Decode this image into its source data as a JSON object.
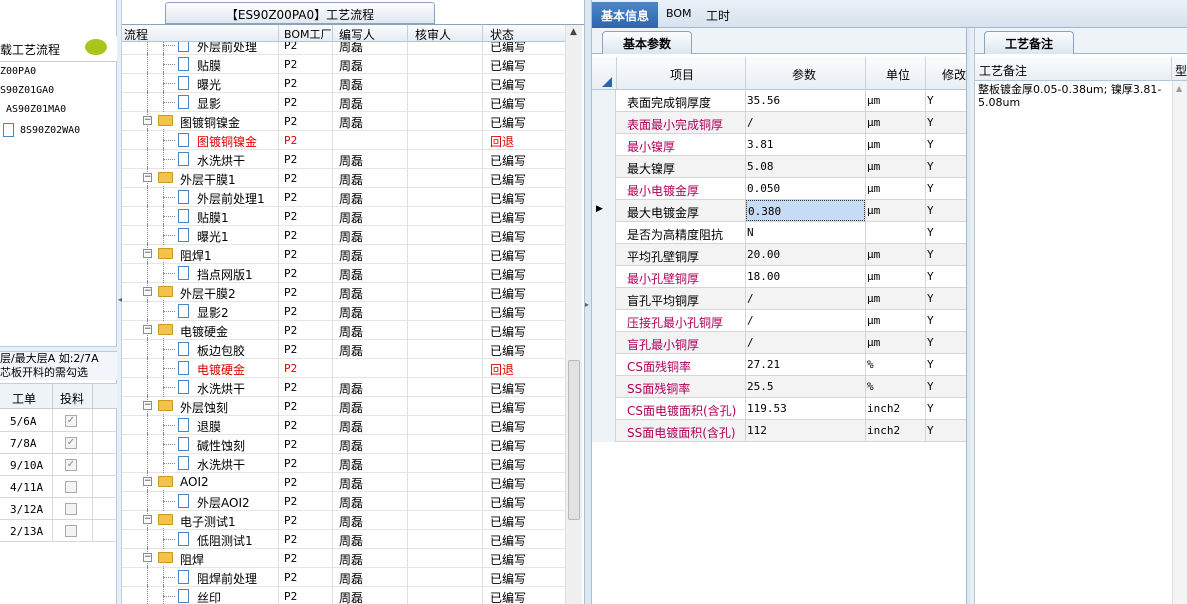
{
  "top_tab": {
    "label": "【ES90Z00PA0】工艺流程"
  },
  "left": {
    "panel_title": "载工艺流程",
    "tree_items": [
      "Z00PA0",
      "S90Z01GA0",
      "AS90Z01MA0",
      "8S90Z02WA0"
    ],
    "note_line1": "层/最大层A 如:2/7A",
    "note_line2": "芯板开料的需勾选",
    "columns": [
      "工单",
      "投料"
    ],
    "rows": [
      {
        "work": "5/6A",
        "checked": true
      },
      {
        "work": "7/8A",
        "checked": true
      },
      {
        "work": "9/10A",
        "checked": true
      },
      {
        "work": "4/11A",
        "checked": false
      },
      {
        "work": "3/12A",
        "checked": false
      },
      {
        "work": "2/13A",
        "checked": false
      }
    ]
  },
  "tree": {
    "columns": [
      "流程",
      "BOM工厂",
      "编写人",
      "核审人",
      "状态"
    ],
    "rows": [
      {
        "level": 2,
        "type": "doc",
        "name": "外层前处理",
        "bom": "P2",
        "writer": "周磊",
        "status": "已编写",
        "red": false
      },
      {
        "level": 2,
        "type": "doc",
        "name": "贴膜",
        "bom": "P2",
        "writer": "周磊",
        "status": "已编写",
        "red": false
      },
      {
        "level": 2,
        "type": "doc",
        "name": "曝光",
        "bom": "P2",
        "writer": "周磊",
        "status": "已编写",
        "red": false
      },
      {
        "level": 2,
        "type": "doc",
        "name": "显影",
        "bom": "P2",
        "writer": "周磊",
        "status": "已编写",
        "red": false
      },
      {
        "level": 1,
        "type": "folder",
        "name": "图镀铜镍金",
        "bom": "P2",
        "writer": "周磊",
        "status": "已编写",
        "red": false
      },
      {
        "level": 2,
        "type": "doc",
        "name": "图镀铜镍金",
        "bom": "P2",
        "writer": "",
        "status": "回退",
        "red": true
      },
      {
        "level": 2,
        "type": "doc",
        "name": "水洗烘干",
        "bom": "P2",
        "writer": "周磊",
        "status": "已编写",
        "red": false
      },
      {
        "level": 1,
        "type": "folder",
        "name": "外层干膜1",
        "bom": "P2",
        "writer": "周磊",
        "status": "已编写",
        "red": false
      },
      {
        "level": 2,
        "type": "doc",
        "name": "外层前处理1",
        "bom": "P2",
        "writer": "周磊",
        "status": "已编写",
        "red": false
      },
      {
        "level": 2,
        "type": "doc",
        "name": "贴膜1",
        "bom": "P2",
        "writer": "周磊",
        "status": "已编写",
        "red": false
      },
      {
        "level": 2,
        "type": "doc",
        "name": "曝光1",
        "bom": "P2",
        "writer": "周磊",
        "status": "已编写",
        "red": false
      },
      {
        "level": 1,
        "type": "folder",
        "name": "阻焊1",
        "bom": "P2",
        "writer": "周磊",
        "status": "已编写",
        "red": false
      },
      {
        "level": 2,
        "type": "doc",
        "name": "挡点网版1",
        "bom": "P2",
        "writer": "周磊",
        "status": "已编写",
        "red": false
      },
      {
        "level": 1,
        "type": "folder",
        "name": "外层干膜2",
        "bom": "P2",
        "writer": "周磊",
        "status": "已编写",
        "red": false
      },
      {
        "level": 2,
        "type": "doc",
        "name": "显影2",
        "bom": "P2",
        "writer": "周磊",
        "status": "已编写",
        "red": false
      },
      {
        "level": 1,
        "type": "folder",
        "name": "电镀硬金",
        "bom": "P2",
        "writer": "周磊",
        "status": "已编写",
        "red": false
      },
      {
        "level": 2,
        "type": "doc",
        "name": "板边包胶",
        "bom": "P2",
        "writer": "周磊",
        "status": "已编写",
        "red": false
      },
      {
        "level": 2,
        "type": "doc",
        "name": "电镀硬金",
        "bom": "P2",
        "writer": "",
        "status": "回退",
        "red": true
      },
      {
        "level": 2,
        "type": "doc",
        "name": "水洗烘干",
        "bom": "P2",
        "writer": "周磊",
        "status": "已编写",
        "red": false
      },
      {
        "level": 1,
        "type": "folder",
        "name": "外层蚀刻",
        "bom": "P2",
        "writer": "周磊",
        "status": "已编写",
        "red": false
      },
      {
        "level": 2,
        "type": "doc",
        "name": "退膜",
        "bom": "P2",
        "writer": "周磊",
        "status": "已编写",
        "red": false
      },
      {
        "level": 2,
        "type": "doc",
        "name": "碱性蚀刻",
        "bom": "P2",
        "writer": "周磊",
        "status": "已编写",
        "red": false
      },
      {
        "level": 2,
        "type": "doc",
        "name": "水洗烘干",
        "bom": "P2",
        "writer": "周磊",
        "status": "已编写",
        "red": false
      },
      {
        "level": 1,
        "type": "folder",
        "name": "AOI2",
        "bom": "P2",
        "writer": "周磊",
        "status": "已编写",
        "red": false
      },
      {
        "level": 2,
        "type": "doc",
        "name": "外层AOI2",
        "bom": "P2",
        "writer": "周磊",
        "status": "已编写",
        "red": false
      },
      {
        "level": 1,
        "type": "folder",
        "name": "电子测试1",
        "bom": "P2",
        "writer": "周磊",
        "status": "已编写",
        "red": false
      },
      {
        "level": 2,
        "type": "doc",
        "name": "低阻测试1",
        "bom": "P2",
        "writer": "周磊",
        "status": "已编写",
        "red": false
      },
      {
        "level": 1,
        "type": "folder",
        "name": "阻焊",
        "bom": "P2",
        "writer": "周磊",
        "status": "已编写",
        "red": false
      },
      {
        "level": 2,
        "type": "doc",
        "name": "阻焊前处理",
        "bom": "P2",
        "writer": "周磊",
        "status": "已编写",
        "red": false
      },
      {
        "level": 2,
        "type": "doc",
        "name": "丝印",
        "bom": "P2",
        "writer": "周磊",
        "status": "已编写",
        "red": false
      }
    ]
  },
  "right": {
    "tabs": [
      "基本信息",
      "BOM",
      "工时"
    ],
    "subtab": "基本参数",
    "columns": [
      "项目",
      "参数",
      "单位",
      "修改"
    ],
    "rows": [
      {
        "item": "表面完成铜厚度",
        "value": "35.56",
        "unit": "μm",
        "mod": "Y",
        "purple": false
      },
      {
        "item": "表面最小完成铜厚",
        "value": "/",
        "unit": "μm",
        "mod": "Y",
        "purple": true
      },
      {
        "item": "最小镍厚",
        "value": "3.81",
        "unit": "μm",
        "mod": "Y",
        "purple": true
      },
      {
        "item": "最大镍厚",
        "value": "5.08",
        "unit": "μm",
        "mod": "Y",
        "purple": false
      },
      {
        "item": "最小电镀金厚",
        "value": "0.050",
        "unit": "μm",
        "mod": "Y",
        "purple": true
      },
      {
        "item": "最大电镀金厚",
        "value": "0.380",
        "unit": "μm",
        "mod": "Y",
        "purple": false
      },
      {
        "item": "是否为高精度阻抗",
        "value": "N",
        "unit": "",
        "mod": "Y",
        "purple": false
      },
      {
        "item": "平均孔壁铜厚",
        "value": "20.00",
        "unit": "μm",
        "mod": "Y",
        "purple": false
      },
      {
        "item": "最小孔壁铜厚",
        "value": "18.00",
        "unit": "μm",
        "mod": "Y",
        "purple": true
      },
      {
        "item": "盲孔平均铜厚",
        "value": "/",
        "unit": "μm",
        "mod": "Y",
        "purple": false
      },
      {
        "item": "压接孔最小孔铜厚",
        "value": "/",
        "unit": "μm",
        "mod": "Y",
        "purple": true
      },
      {
        "item": "盲孔最小铜厚",
        "value": "/",
        "unit": "μm",
        "mod": "Y",
        "purple": true
      },
      {
        "item": "CS面残铜率",
        "value": "27.21",
        "unit": "%",
        "mod": "Y",
        "purple": true
      },
      {
        "item": "SS面残铜率",
        "value": "25.5",
        "unit": "%",
        "mod": "Y",
        "purple": true
      },
      {
        "item": "CS面电镀面积(含孔)",
        "value": "119.53",
        "unit": "inch2",
        "mod": "Y",
        "purple": true
      },
      {
        "item": "SS面电镀面积(含孔)",
        "value": "112",
        "unit": "inch2",
        "mod": "Y",
        "purple": true
      }
    ],
    "remark_tab": "工艺备注",
    "remark_header": "工艺备注",
    "remark_header2": "型",
    "remark_text": "整板镀金厚0.05-0.38um; 镍厚3.81-5.08um"
  }
}
